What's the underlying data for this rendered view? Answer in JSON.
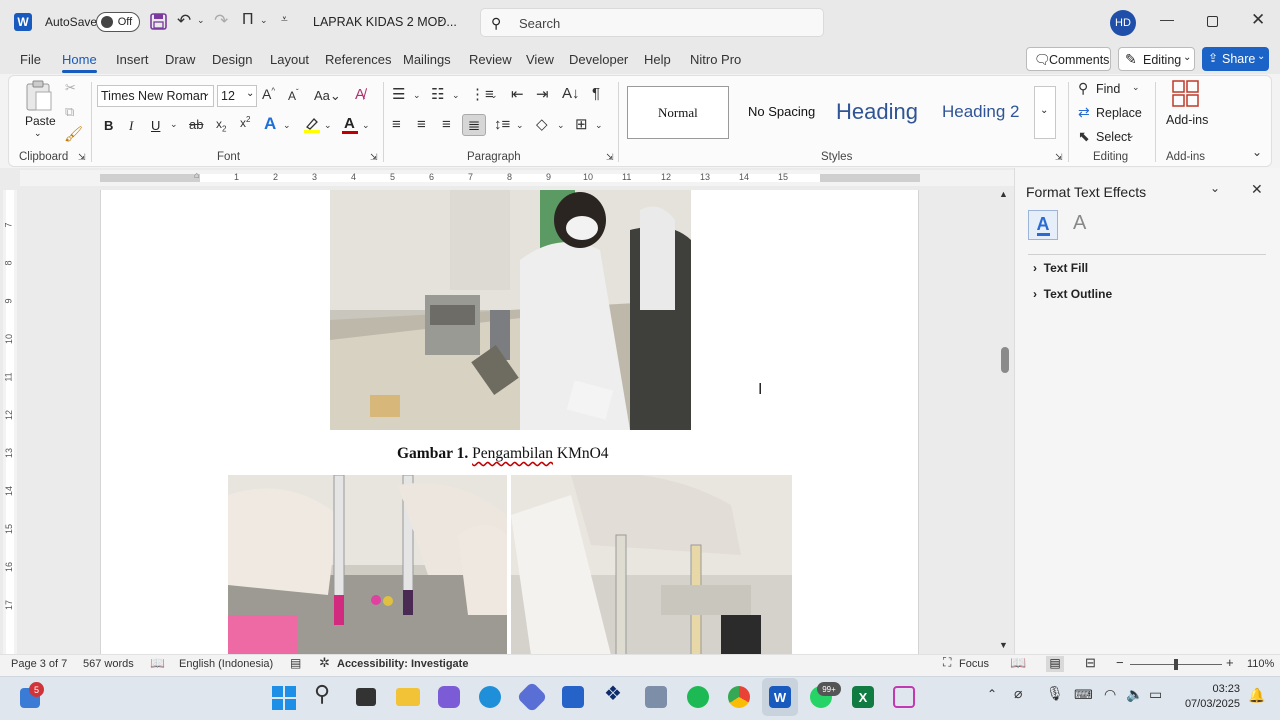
{
  "titlebar": {
    "autosave_label": "AutoSave",
    "autosave_state": "Off",
    "doc_title": "LAPRAK KIDAS 2 MOD...",
    "search_placeholder": "Search",
    "user_initials": "HD"
  },
  "menu": {
    "tabs": [
      "File",
      "Home",
      "Insert",
      "Draw",
      "Design",
      "Layout",
      "References",
      "Mailings",
      "Review",
      "View",
      "Developer",
      "Help",
      "Nitro Pro"
    ],
    "active_tab": "Home",
    "comments_label": "Comments",
    "editing_label": "Editing",
    "share_label": "Share"
  },
  "ribbon": {
    "clipboard": {
      "paste_label": "Paste",
      "group_label": "Clipboard"
    },
    "font": {
      "family": "Times New Roman",
      "size": "12",
      "group_label": "Font",
      "bold": "B",
      "italic": "I",
      "underline": "U"
    },
    "paragraph": {
      "group_label": "Paragraph"
    },
    "styles": {
      "items": [
        "Normal",
        "No Spacing",
        "Heading",
        "Heading 2"
      ],
      "group_label": "Styles"
    },
    "editing": {
      "find_label": "Find",
      "replace_label": "Replace",
      "select_label": "Select",
      "group_label": "Editing"
    },
    "addins": {
      "addins_label": "Add-ins",
      "group_label": "Add-ins"
    }
  },
  "ruler": {
    "numbers": [
      "1",
      "2",
      "3",
      "4",
      "5",
      "6",
      "7",
      "8",
      "9",
      "10",
      "11",
      "12",
      "13",
      "14",
      "15"
    ],
    "vertical_numbers": [
      "7",
      "8",
      "9",
      "10",
      "11",
      "12",
      "13",
      "14",
      "15",
      "16",
      "17"
    ]
  },
  "document": {
    "caption_bold": "Gambar 1.",
    "caption_underlined": "Pengambilan",
    "caption_rest": " KMnO4"
  },
  "taskpane": {
    "title": "Format Text Effects",
    "sections": [
      "Text Fill",
      "Text Outline"
    ]
  },
  "status": {
    "page": "Page 3 of 7",
    "words": "567 words",
    "language": "English (Indonesia)",
    "accessibility": "Accessibility: Investigate",
    "focus": "Focus",
    "zoom": "110%"
  },
  "taskbar": {
    "widget_badge": "5",
    "whatsapp_badge": "99+",
    "time": "03:23",
    "date": "07/03/2025"
  },
  "colors": {
    "word_blue": "#185abd",
    "share_blue": "#1b63c6",
    "avatar": "#1f4fa8",
    "font_color_red": "#c00000",
    "highlight_yellow": "#ffff00"
  }
}
